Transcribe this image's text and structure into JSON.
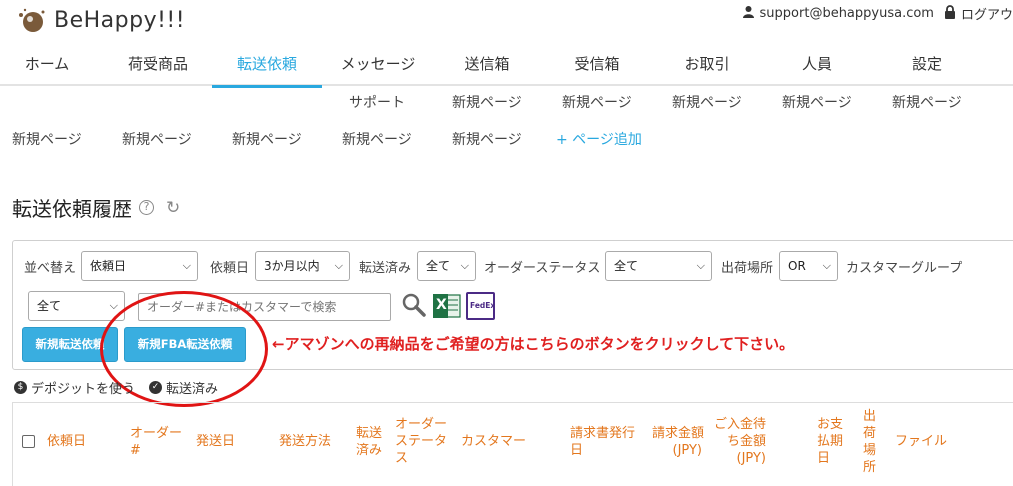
{
  "app": {
    "logo_text": "BeHappy!!!",
    "user_email": "support@behappyusa.com",
    "logout_label": "ログアウ"
  },
  "nav": [
    "ホーム",
    "荷受商品",
    "転送依頼",
    "メッセージ",
    "送信箱",
    "受信箱",
    "お取引",
    "人員",
    "設定"
  ],
  "nav_active_index": 2,
  "subnav": {
    "row1": [
      "サポート",
      "新規ページ",
      "新規ページ",
      "新規ページ",
      "新規ページ",
      "新規ページ"
    ],
    "row2": [
      "新規ページ",
      "新規ページ",
      "新規ページ",
      "新規ページ",
      "新規ページ"
    ],
    "add_page": "+ ページ追加"
  },
  "page": {
    "title": "転送依頼履歴"
  },
  "filters": {
    "sort_label": "並べ替え",
    "sort_value": "依頼日",
    "date_label": "依頼日",
    "date_value": "3か月以内",
    "forwarded_label": "転送済み",
    "forwarded_value": "全て",
    "order_status_label": "オーダーステータス",
    "order_status_value": "全て",
    "ship_from_label": "出荷場所",
    "ship_from_value": "OR",
    "customer_group_label": "カスタマーグループ",
    "customer_group_value": "全て",
    "search_placeholder": "オーダー#またはカスタマーで検索",
    "excel_letter": "X",
    "fedex_label": "FedEx"
  },
  "buttons": {
    "new_forward": "新規転送依頼",
    "new_fba_forward": "新規FBA転送依頼"
  },
  "notice": "←アマゾンへの再納品をご希望の方はこちらのボタンをクリックして下さい。",
  "legend": {
    "deposit_symbol": "$",
    "deposit": "デポジットを使う",
    "forwarded": "転送済み"
  },
  "table": {
    "columns": {
      "request_date": "依頼日",
      "order_no": "オーダー\n#",
      "ship_date": "発送日",
      "ship_method": "発送方法",
      "forwarded": "転送\n済み",
      "order_status": "オーダー\nステータ\nス",
      "customer": "カスタマー",
      "invoice_date": "請求書発行\n日",
      "billed_amount": "請求金額\n(JPY)",
      "pending_amount": "ご入金待\nち金額\n(JPY)",
      "payment_due": "お支\n払期\n日",
      "ship_location": "出\n荷\n場\n所",
      "file": "ファイル"
    }
  },
  "colors": {
    "accent": "#29a8df",
    "button": "#39aee0",
    "notice": "#e02020",
    "header_text": "#e3771e"
  }
}
